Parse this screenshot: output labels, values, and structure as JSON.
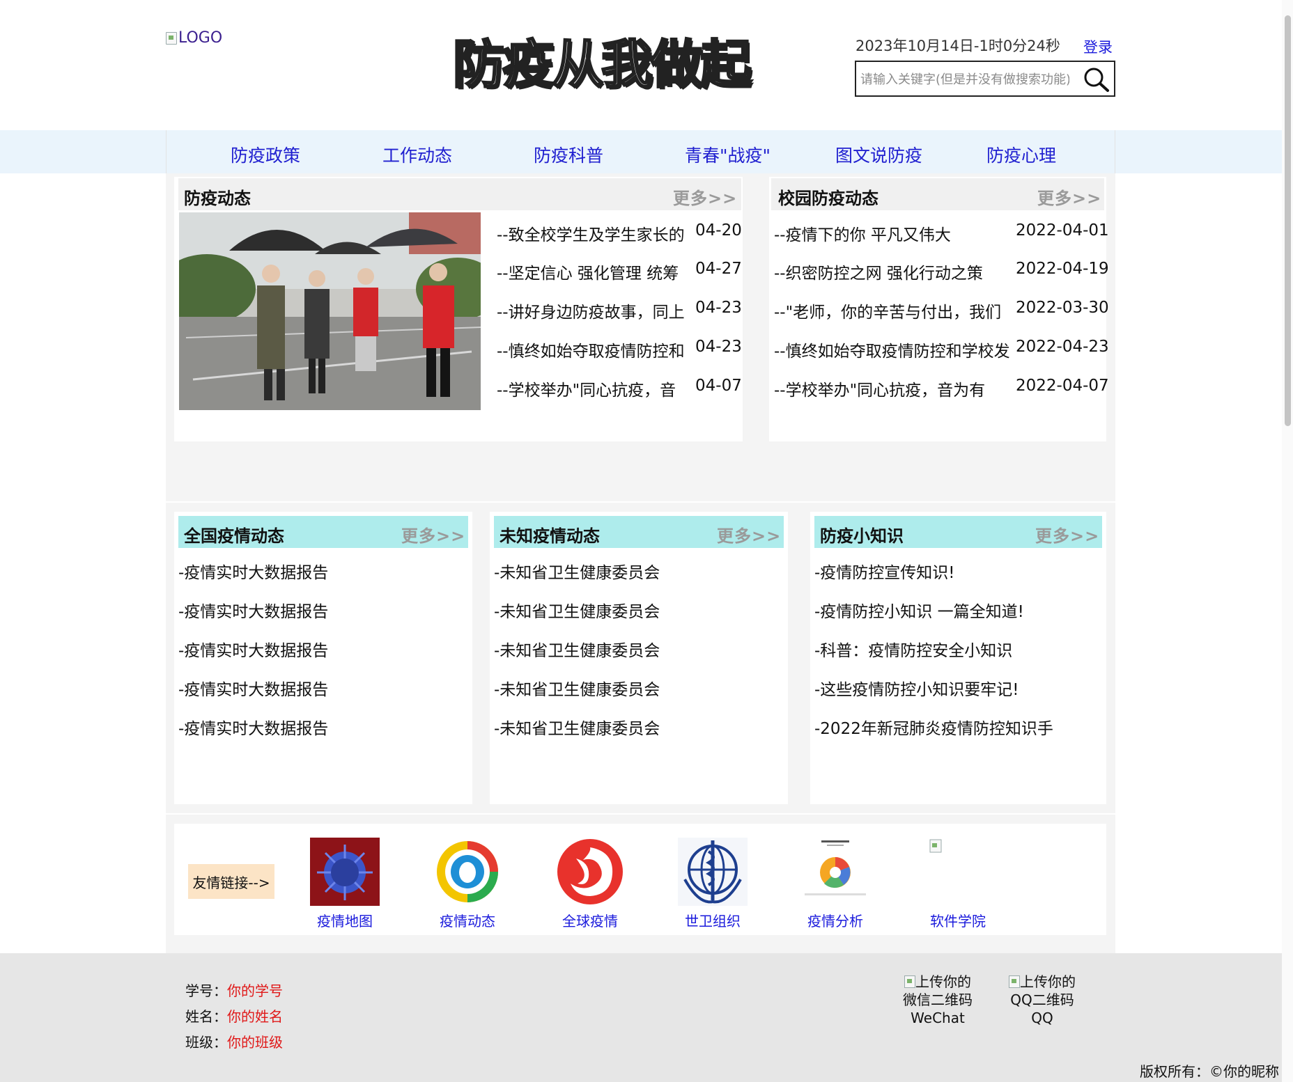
{
  "header": {
    "logo_alt": "LOGO",
    "site_title": "防疫从我做起",
    "clock": "2023年10月14日-1时0分24秒",
    "login_label": "登录",
    "search_placeholder": "请输入关键字(但是并没有做搜索功能)",
    "search_icon": "search-icon"
  },
  "nav": {
    "items": [
      "防疫政策",
      "工作动态",
      "防疫科普",
      "青春\"战疫\"",
      "图文说防疫",
      "防疫心理"
    ]
  },
  "epidemic_news": {
    "title": "防疫动态",
    "more_label": "更多>>",
    "image_alt": "volunteers with umbrellas",
    "rows": [
      {
        "text": "--致全校学生及学生家长的",
        "date": "04-20"
      },
      {
        "text": "--坚定信心 强化管理 统筹",
        "date": "04-27"
      },
      {
        "text": "--讲好身边防疫故事，同上",
        "date": "04-23"
      },
      {
        "text": "--慎终如始夺取疫情防控和",
        "date": "04-23"
      },
      {
        "text": "--学校举办\"同心抗疫，音",
        "date": "04-07"
      }
    ]
  },
  "campus_news": {
    "title": "校园防疫动态",
    "more_label": "更多>>",
    "rows": [
      {
        "text": "--疫情下的你 平凡又伟大",
        "date": "2022-04-01"
      },
      {
        "text": "--织密防控之网 强化行动之策",
        "date": "2022-04-19"
      },
      {
        "text": "--\"老师，你的辛苦与付出，我们",
        "date": "2022-03-30"
      },
      {
        "text": "--慎终如始夺取疫情防控和学校发",
        "date": "2022-04-23"
      },
      {
        "text": "--学校举办\"同心抗疫，音为有",
        "date": "2022-04-07"
      }
    ]
  },
  "national": {
    "title": "全国疫情动态",
    "more_label": "更多>>",
    "rows": [
      "-疫情实时大数据报告",
      "-疫情实时大数据报告",
      "-疫情实时大数据报告",
      "-疫情实时大数据报告",
      "-疫情实时大数据报告"
    ]
  },
  "unknown": {
    "title": "未知疫情动态",
    "more_label": "更多>>",
    "rows": [
      "-未知省卫生健康委员会",
      "-未知省卫生健康委员会",
      "-未知省卫生健康委员会",
      "-未知省卫生健康委员会",
      "-未知省卫生健康委员会"
    ]
  },
  "knowledge": {
    "title": "防疫小知识",
    "more_label": "更多>>",
    "rows": [
      "-疫情防控宣传知识!",
      "-疫情防控小知识 一篇全知道!",
      "-科普：疫情防控安全小知识",
      "-这些疫情防控小知识要牢记!",
      "-2022年新冠肺炎疫情防控知识手"
    ]
  },
  "links": {
    "label": "友情链接-->",
    "items": [
      {
        "label": "疫情地图",
        "icon": "virus-icon"
      },
      {
        "label": "疫情动态",
        "icon": "tencent-news-icon"
      },
      {
        "label": "全球疫情",
        "icon": "phoenix-icon"
      },
      {
        "label": "世卫组织",
        "icon": "who-icon"
      },
      {
        "label": "疫情分析",
        "icon": "analysis-chart-icon"
      },
      {
        "label": "软件学院",
        "icon": "broken-image-icon"
      }
    ]
  },
  "footer": {
    "student_id_label": "学号：",
    "student_id_value": "你的学号",
    "name_label": "姓名：",
    "name_value": "你的姓名",
    "class_label": "班级：",
    "class_value": "你的班级",
    "wechat_alt_1": "上传你的",
    "wechat_alt_2": "微信二维码",
    "wechat_caption": "WeChat",
    "qq_alt_1": "上传你的",
    "qq_alt_2": "QQ二维码",
    "qq_caption": "QQ",
    "copyright": "版权所有：©你的昵称"
  },
  "colors": {
    "nav_bg": "#eaf4fc",
    "link_blue": "#1a1adc",
    "section_head_cyan": "#aeecec",
    "section_head_gray": "#f0f0f0",
    "footer_red": "#e01818",
    "links_label_bg": "#fce4c6"
  }
}
